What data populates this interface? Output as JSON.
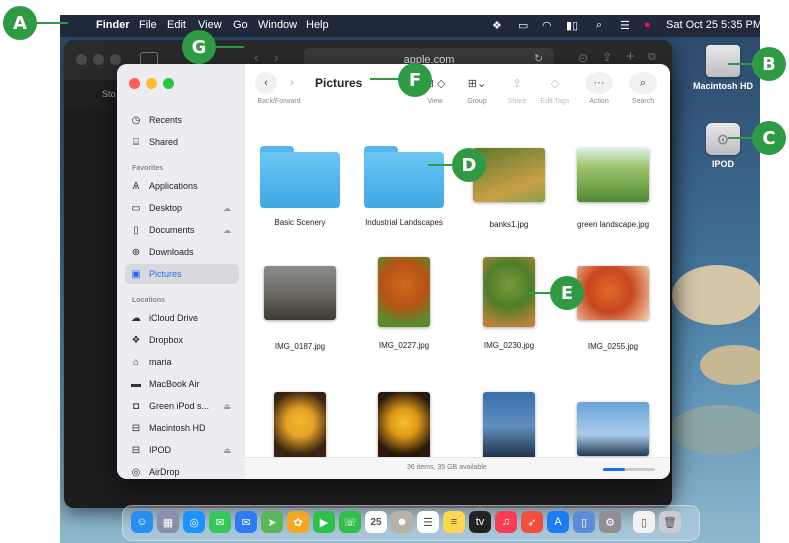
{
  "menubar": {
    "app_name": "Finder",
    "menus": [
      "File",
      "Edit",
      "View",
      "Go",
      "Window",
      "Help"
    ],
    "datetime": "Sat Oct 25  5:35 PM"
  },
  "desktop": {
    "icons": [
      {
        "label": "Macintosh HD",
        "icon": "hard-drive-icon"
      },
      {
        "label": "IPOD",
        "icon": "ipod-drive-icon"
      }
    ]
  },
  "safari": {
    "url": "apple.com",
    "tab_text": "Sto"
  },
  "finder": {
    "title": "Pictures",
    "back_forward_label": "Back/Forward",
    "toolbar": [
      {
        "label": "View",
        "icon": "grid-view-icon"
      },
      {
        "label": "Group",
        "icon": "group-icon"
      },
      {
        "label": "Share",
        "icon": "share-icon"
      },
      {
        "label": "Edit Tags",
        "icon": "tag-icon"
      },
      {
        "label": "Action",
        "icon": "ellipsis-icon"
      },
      {
        "label": "Search",
        "icon": "search-icon"
      }
    ],
    "sidebar": {
      "top": [
        {
          "label": "Recents",
          "icon": "clock-icon"
        },
        {
          "label": "Shared",
          "icon": "shared-folder-icon"
        }
      ],
      "favorites_heading": "Favorites",
      "favorites": [
        {
          "label": "Applications",
          "icon": "applications-icon"
        },
        {
          "label": "Desktop",
          "icon": "desktop-icon"
        },
        {
          "label": "Documents",
          "icon": "document-icon"
        },
        {
          "label": "Downloads",
          "icon": "download-icon"
        },
        {
          "label": "Pictures",
          "icon": "photo-icon",
          "selected": true
        }
      ],
      "locations_heading": "Locations",
      "locations": [
        {
          "label": "iCloud Drive",
          "icon": "cloud-icon"
        },
        {
          "label": "Dropbox",
          "icon": "dropbox-icon"
        },
        {
          "label": "maria",
          "icon": "home-icon"
        },
        {
          "label": "MacBook Air",
          "icon": "laptop-icon"
        },
        {
          "label": "Green iPod s...",
          "icon": "ipod-icon",
          "eject": true
        },
        {
          "label": "Macintosh HD",
          "icon": "drive-icon"
        },
        {
          "label": "IPOD",
          "icon": "drive-icon",
          "eject": true
        },
        {
          "label": "AirDrop",
          "icon": "airdrop-icon"
        }
      ]
    },
    "items": [
      {
        "name": "Basic Scenery",
        "kind": "folder"
      },
      {
        "name": "Industrial Landscapes",
        "kind": "folder"
      },
      {
        "name": "banks1.jpg",
        "kind": "image",
        "colors": [
          "#5a7a2a",
          "#c9a048"
        ]
      },
      {
        "name": "green landscape.jpg",
        "kind": "image",
        "colors": [
          "#9cc46a",
          "#4f8a35"
        ]
      },
      {
        "name": "IMG_0187.jpg",
        "kind": "image",
        "colors": [
          "#6d6a62",
          "#a9a59a"
        ]
      },
      {
        "name": "IMG_0227.jpg",
        "kind": "image",
        "colors": [
          "#d06a1e",
          "#5b8a2c"
        ]
      },
      {
        "name": "IMG_0230.jpg",
        "kind": "image",
        "colors": [
          "#4e7e2a",
          "#b7823a"
        ]
      },
      {
        "name": "IMG_0255.jpg",
        "kind": "image",
        "colors": [
          "#c8461f",
          "#f0c4a0"
        ]
      },
      {
        "name": "",
        "kind": "image",
        "colors": [
          "#2a1a0c",
          "#e09a1a"
        ]
      },
      {
        "name": "",
        "kind": "image",
        "colors": [
          "#3a2410",
          "#e6a32a"
        ]
      },
      {
        "name": "",
        "kind": "image",
        "colors": [
          "#3a6ea8",
          "#1c2a3c"
        ]
      },
      {
        "name": "",
        "kind": "image",
        "colors": [
          "#6aa4d8",
          "#203850"
        ]
      }
    ],
    "status": "36 items, 35 GB available"
  },
  "dock": {
    "apps": [
      {
        "name": "finder-icon",
        "color": "#2a8df0"
      },
      {
        "name": "launchpad-icon",
        "color": "#8a8fa8"
      },
      {
        "name": "safari-icon",
        "color": "#1e90ff"
      },
      {
        "name": "messages-icon",
        "color": "#34c759"
      },
      {
        "name": "mail-icon",
        "color": "#2f7bf5"
      },
      {
        "name": "maps-icon",
        "color": "#5ab65a"
      },
      {
        "name": "photos-icon",
        "color": "#f5a623"
      },
      {
        "name": "facetime-icon",
        "color": "#2fbf4a"
      },
      {
        "name": "phone-icon",
        "color": "#2fbf4a"
      },
      {
        "name": "calendar-icon",
        "color": "#ffffff"
      },
      {
        "name": "contacts-icon",
        "color": "#b9b2a7"
      },
      {
        "name": "reminders-icon",
        "color": "#ffffff"
      },
      {
        "name": "notes-icon",
        "color": "#ffd54f"
      },
      {
        "name": "tv-icon",
        "color": "#222222"
      },
      {
        "name": "music-icon",
        "color": "#fa3c52"
      },
      {
        "name": "rocket-icon",
        "color": "#f0503c"
      },
      {
        "name": "app-store-icon",
        "color": "#1e7cf2"
      },
      {
        "name": "preview-icon",
        "color": "#5a8fd8"
      },
      {
        "name": "system-settings-icon",
        "color": "#8e8e93"
      },
      {
        "name": "documents-icon",
        "color": "#f2f2f2"
      },
      {
        "name": "trash-icon",
        "color": "#c9ccd2"
      }
    ],
    "calendar_day": "25"
  },
  "callouts": [
    "A",
    "B",
    "C",
    "D",
    "E",
    "F",
    "G"
  ]
}
